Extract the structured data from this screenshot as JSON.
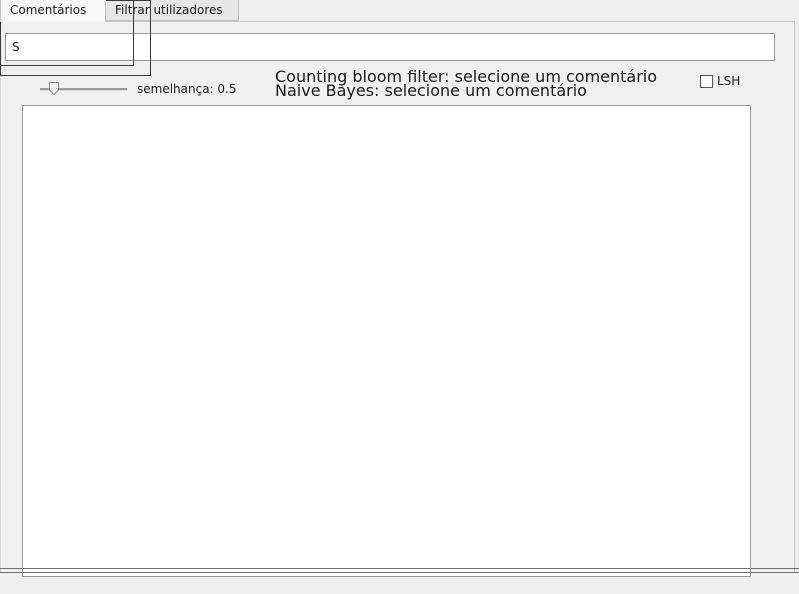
{
  "tabs": [
    {
      "label": "Comentários",
      "active": true
    },
    {
      "label": "Filtrar utilizadores",
      "active": false
    }
  ],
  "search": {
    "value": "S",
    "placeholder": ""
  },
  "similarity": {
    "label": "semelhança: 0.5",
    "value": 0.5
  },
  "status": {
    "bloom": "Counting bloom filter: selecione um comentário",
    "bayes": "Naive Bayes: selecione um comentário"
  },
  "lsh": {
    "label": "LSH",
    "checked": false
  },
  "results": {
    "items": []
  },
  "colors": {
    "window_bg": "#efefef",
    "input_bg": "#ffffff",
    "border": "#9a9a9a"
  }
}
